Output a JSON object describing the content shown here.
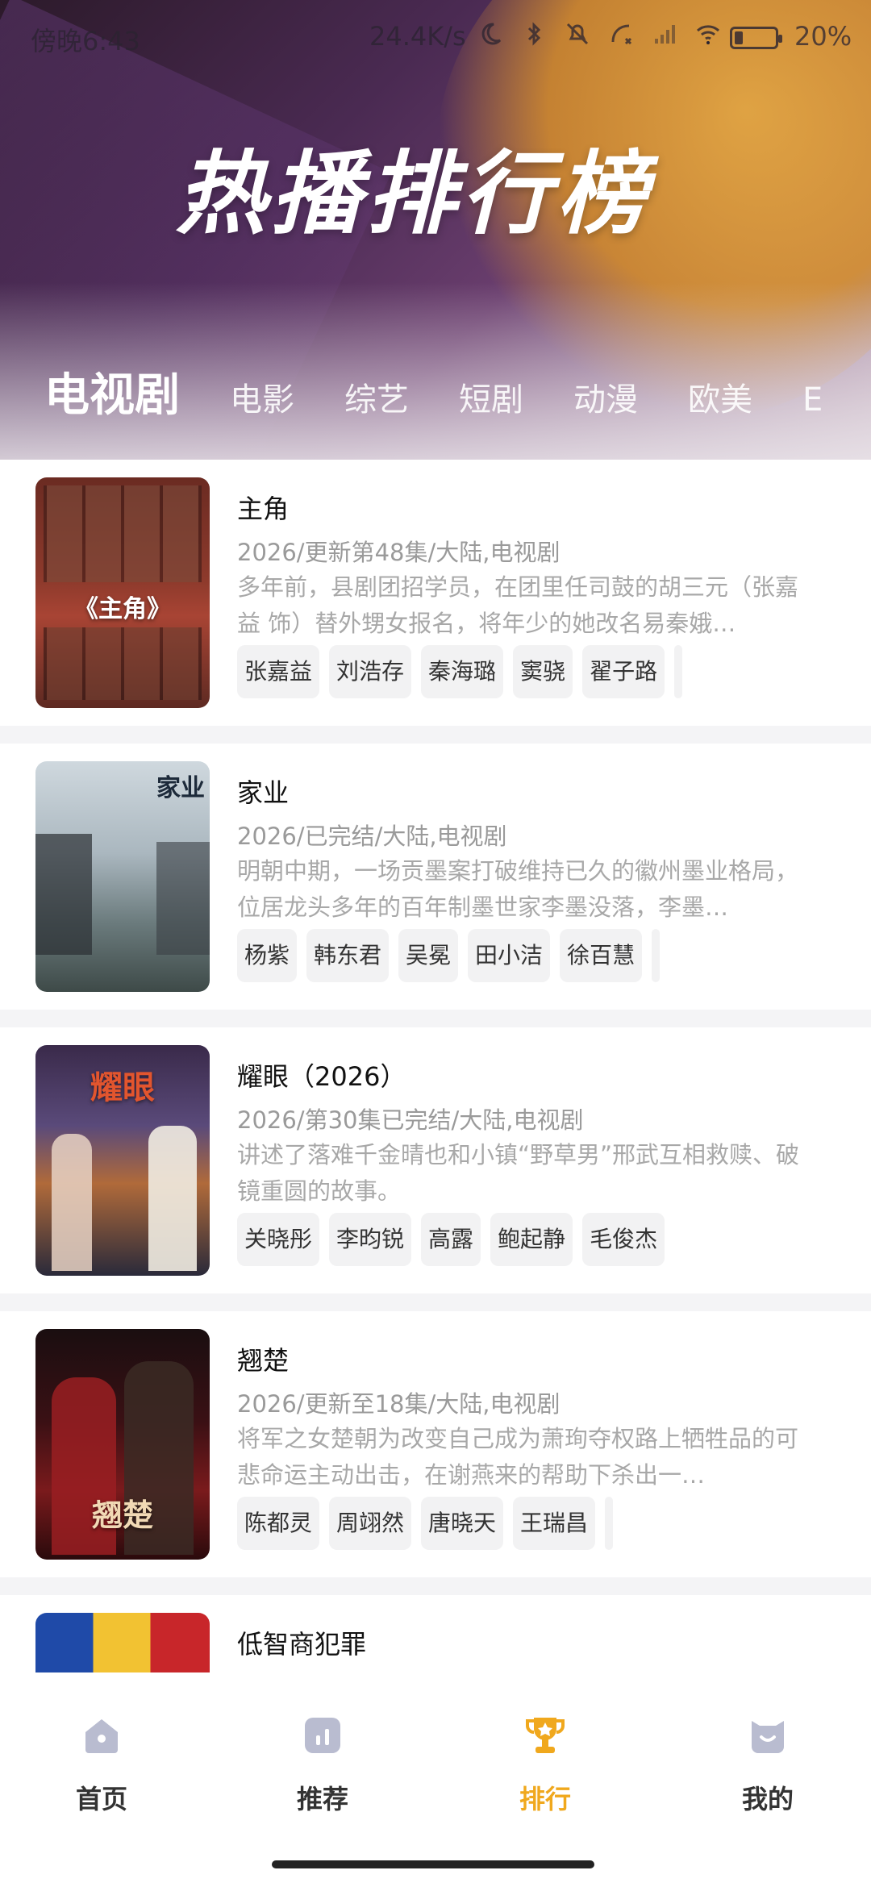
{
  "status_bar": {
    "time": "傍晚6:43",
    "speed": "24.4K/s",
    "battery": "20%"
  },
  "header": {
    "title": "热播排行榜",
    "tabs": [
      "电视剧",
      "电影",
      "综艺",
      "短剧",
      "动漫",
      "欧美",
      "E"
    ]
  },
  "items": [
    {
      "title": "主角",
      "poster_text": "《主角》",
      "meta": "2026/更新第48集/大陆,电视剧",
      "desc": "多年前，县剧团招学员，在团里任司鼓的胡三元（张嘉益 饰）替外甥女报名，将年少的她改名易秦娥…",
      "tags": [
        "张嘉益",
        "刘浩存",
        "秦海璐",
        "窦骁",
        "翟子路"
      ]
    },
    {
      "title": "家业",
      "poster_text": "家业",
      "meta": "2026/已完结/大陆,电视剧",
      "desc": "明朝中期，一场贡墨案打破维持已久的徽州墨业格局，位居龙头多年的百年制墨世家李墨没落，李墨…",
      "tags": [
        "杨紫",
        "韩东君",
        "吴冕",
        "田小洁",
        "徐百慧"
      ]
    },
    {
      "title": "耀眼（2026）",
      "poster_text": "耀眼",
      "meta": "2026/第30集已完结/大陆,电视剧",
      "desc": "讲述了落难千金晴也和小镇“野草男”邢武互相救赎、破镜重圆的故事。",
      "tags": [
        "关晓彤",
        "李昀锐",
        "高露",
        "鲍起静",
        "毛俊杰"
      ]
    },
    {
      "title": "翘楚",
      "poster_text": "翘楚",
      "meta": "2026/更新至18集/大陆,电视剧",
      "desc": "将军之女楚朝为改变自己成为萧珣夺权路上牺牲品的可悲命运主动出击，在谢燕来的帮助下杀出一…",
      "tags": [
        "陈都灵",
        "周翊然",
        "唐晓天",
        "王瑞昌"
      ]
    },
    {
      "title": "低智商犯罪",
      "poster_text": "",
      "meta": "",
      "desc": "",
      "tags": []
    }
  ],
  "bottom_nav": [
    {
      "label": "首页",
      "icon": "home-icon",
      "active": false
    },
    {
      "label": "推荐",
      "icon": "chart-icon",
      "active": false
    },
    {
      "label": "排行",
      "icon": "trophy-icon",
      "active": true
    },
    {
      "label": "我的",
      "icon": "profile-icon",
      "active": false
    }
  ],
  "colors": {
    "accent": "#f0a81d",
    "inactive_nav": "#b9bcd0"
  }
}
